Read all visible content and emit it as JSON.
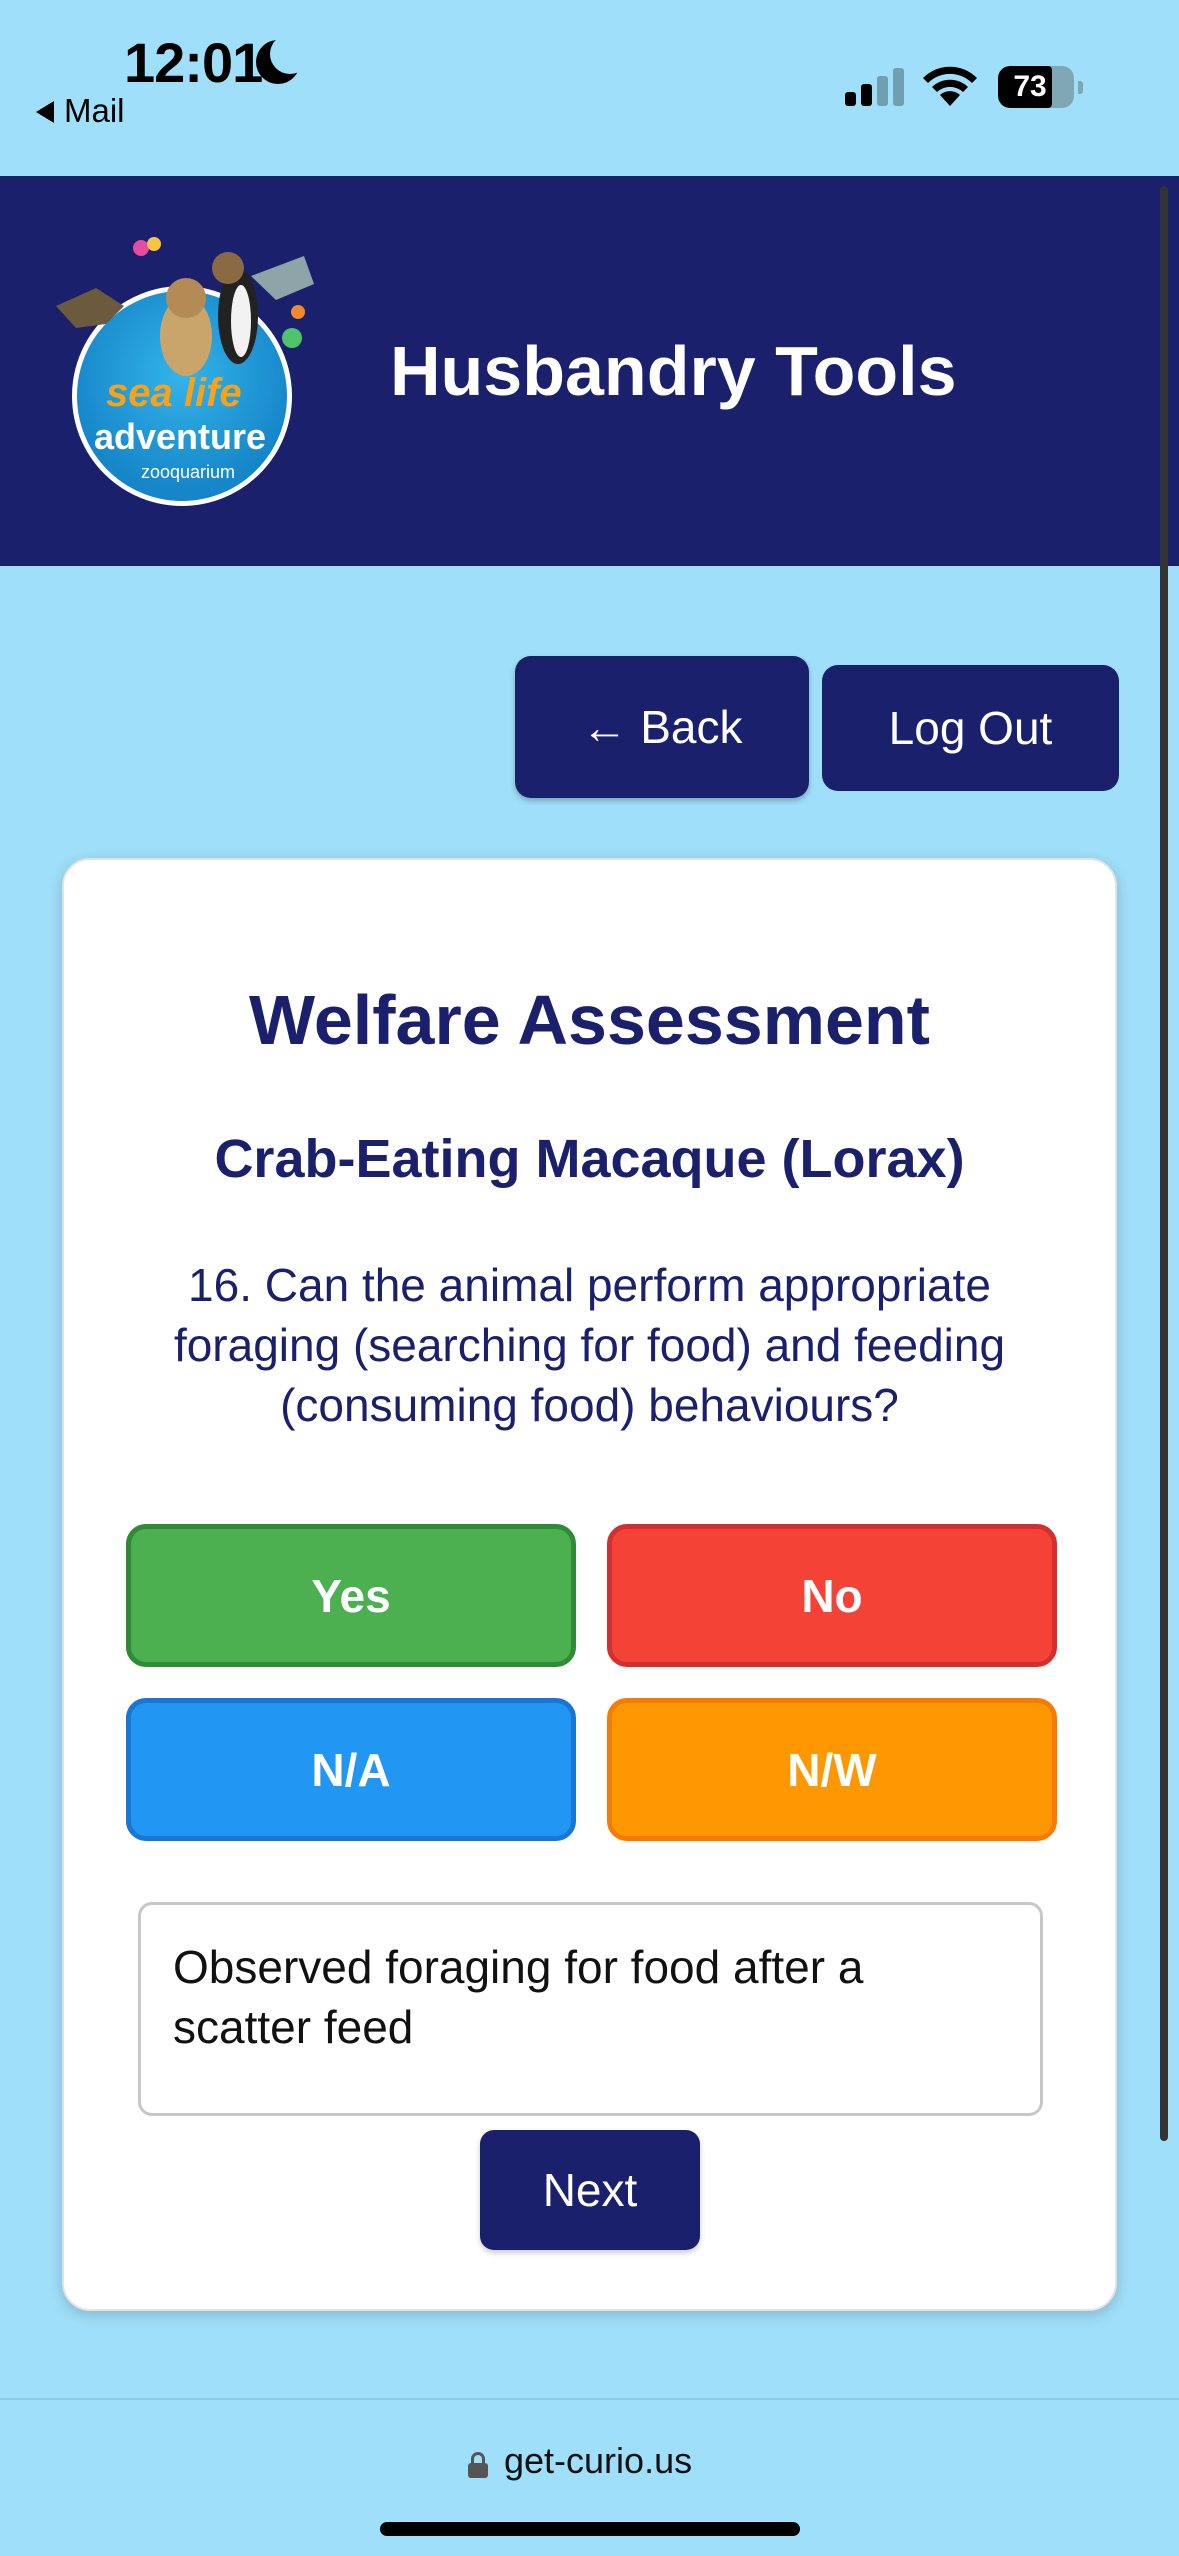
{
  "status_bar": {
    "time": "12:01",
    "back_app": "Mail",
    "battery": "73"
  },
  "header": {
    "title": "Husbandry Tools",
    "logo": {
      "line1": "sea life",
      "line2": "adventure",
      "line3": "zooquarium"
    }
  },
  "nav": {
    "back_label": "← Back",
    "logout_label": "Log Out"
  },
  "assessment": {
    "title": "Welfare Assessment",
    "subject": "Crab-Eating Macaque (Lorax)",
    "question": "16. Can the animal perform appropriate foraging (searching for food) and feeding (consuming food) behaviours?",
    "answers": {
      "yes": "Yes",
      "no": "No",
      "na": "N/A",
      "nw": "N/W"
    },
    "notes_value": "Observed foraging for food after a scatter feed",
    "next_label": "Next"
  },
  "browser": {
    "url": "get-curio.us"
  },
  "colors": {
    "page_bg": "#a0dff9",
    "header_bg": "#1a206b",
    "yes": "#4caf50",
    "no": "#f44336",
    "na": "#2196f3",
    "nw": "#ff9800"
  }
}
